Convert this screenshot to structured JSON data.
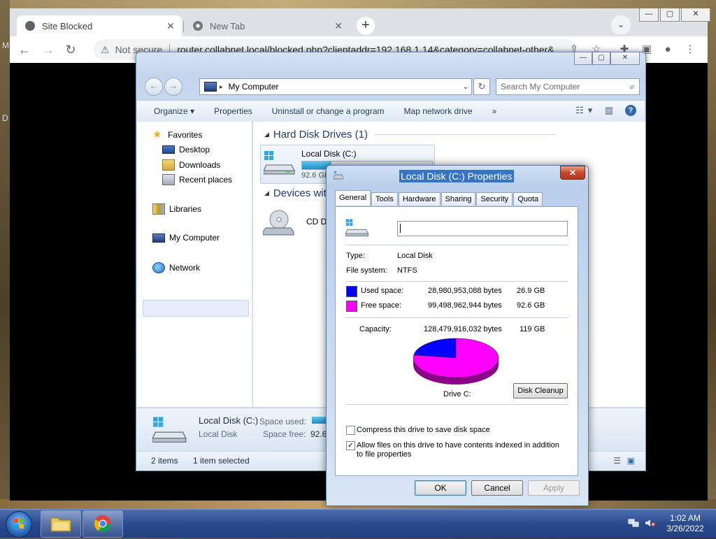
{
  "chrome": {
    "tabs": [
      {
        "title": "Site Blocked",
        "close": "✕"
      },
      {
        "title": "New Tab",
        "close": "✕"
      }
    ],
    "new_tab": "+",
    "tab_search": "⌄",
    "window_buttons": {
      "minimize": "—",
      "maximize": "▢",
      "close": "✕"
    },
    "nav": {
      "back": "←",
      "forward": "→",
      "reload": "↻"
    },
    "omnibox": {
      "warning": "⚠",
      "security": "Not secure",
      "url": "router.collabnet.local/blocked.php?clientaddr=192.168.1.14&category=collabnet-other&"
    },
    "page_edge": {
      "top_left": "M",
      "left": "D"
    }
  },
  "explorer": {
    "window_buttons": {
      "minimize": "—",
      "maximize": "▢",
      "close": "✕"
    },
    "back": "←",
    "forward": "→",
    "address": {
      "text": "My Computer",
      "separator": "▸",
      "dropdown": "⌄"
    },
    "refresh": "↻",
    "search": {
      "placeholder": "Search My Computer",
      "icon": "⌕"
    },
    "commands": [
      "Organize ▾",
      "Properties",
      "Uninstall or change a program",
      "Map network drive",
      "»"
    ],
    "view_dropdown": "▾",
    "help": "?",
    "nav": {
      "favorites": "Favorites",
      "desktop": "Desktop",
      "downloads": "Downloads",
      "recent": "Recent places",
      "libraries": "Libraries",
      "computer": "My Computer",
      "network": "Network"
    },
    "groups": {
      "hdd": "Hard Disk Drives (1)",
      "devices": "Devices with"
    },
    "local_disk": {
      "name": "Local Disk (C:)",
      "free_short": "92.6 GB",
      "used_fraction": 0.226
    },
    "cd_drive": {
      "name": "CD Dr"
    },
    "details": {
      "name": "Local Disk (C:)",
      "type": "Local Disk",
      "space_used_label": "Space used:",
      "space_free_label": "Space free:",
      "space_free_value": "92.6"
    },
    "status": {
      "items": "2 items",
      "selected": "1 item selected"
    }
  },
  "properties": {
    "title": "Local Disk (C:) Properties",
    "close": "✕",
    "tabs": [
      "General",
      "Tools",
      "Hardware",
      "Sharing",
      "Security",
      "Quota"
    ],
    "name_value": "",
    "type_label": "Type:",
    "type_value": "Local Disk",
    "fs_label": "File system:",
    "fs_value": "NTFS",
    "used": {
      "label": "Used space:",
      "bytes": "28,980,953,088 bytes",
      "size": "26.9 GB",
      "color": "#0000ff"
    },
    "free": {
      "label": "Free space:",
      "bytes": "99,498,962,944 bytes",
      "size": "92.6 GB",
      "color": "#ff00ff"
    },
    "capacity": {
      "label": "Capacity:",
      "bytes": "128,479,916,032 bytes",
      "size": "119 GB"
    },
    "drive_label": "Drive C:",
    "cleanup_button": "Disk Cleanup",
    "compress_label": "Compress this drive to save disk space",
    "compress_checked": false,
    "index_label": "Allow files on this drive to have contents indexed in addition to file properties",
    "index_checked": true,
    "check_mark": "✓",
    "buttons": {
      "ok": "OK",
      "cancel": "Cancel",
      "apply": "Apply"
    }
  },
  "taskbar": {
    "clock_time": "1:02 AM",
    "clock_date": "3/26/2022"
  }
}
